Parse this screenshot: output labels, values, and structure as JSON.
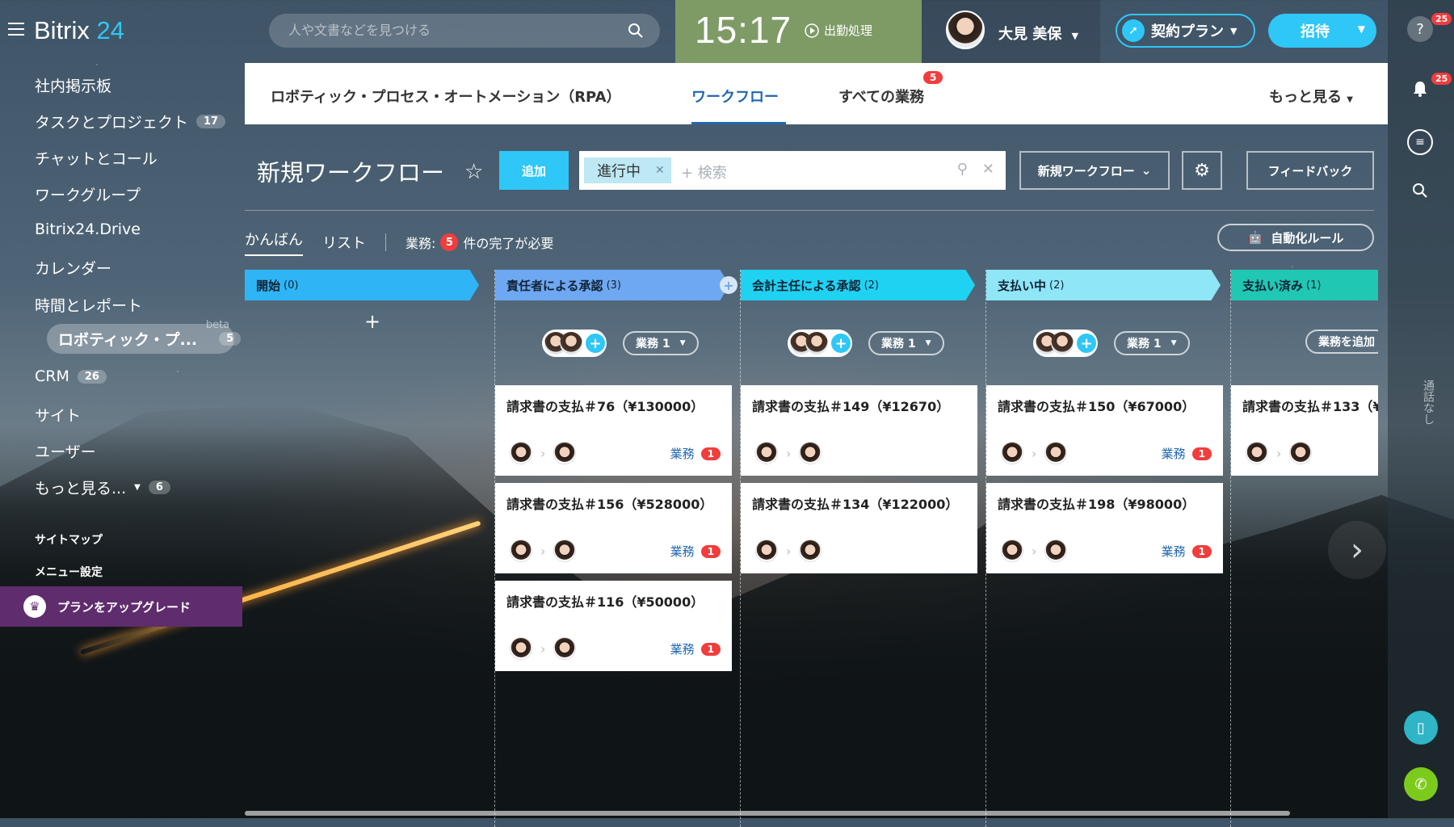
{
  "brand": {
    "name": "Bitrix",
    "num": "24"
  },
  "search": {
    "placeholder": "人や文書などを見つける"
  },
  "clock": {
    "time": "15:17",
    "attend": "出勤処理"
  },
  "user": {
    "name": "大見 美保"
  },
  "plan_label": "契約プラン",
  "invite_label": "招待",
  "rail": {
    "help_badge": "25",
    "bell_badge": "25",
    "vertical_text": "通話なし"
  },
  "sidebar": {
    "items": [
      {
        "label": "社内掲示板",
        "count": ""
      },
      {
        "label": "タスクとプロジェクト",
        "count": "17"
      },
      {
        "label": "チャットとコール",
        "count": ""
      },
      {
        "label": "ワークグループ",
        "count": ""
      },
      {
        "label": "Bitrix24.Drive",
        "count": ""
      },
      {
        "label": "カレンダー",
        "count": ""
      },
      {
        "label": "時間とレポート",
        "count": ""
      },
      {
        "label": "ロボティック・プ...",
        "count": "5",
        "beta": "beta"
      },
      {
        "label": "CRM",
        "count": "26"
      },
      {
        "label": "サイト",
        "count": ""
      },
      {
        "label": "ユーザー",
        "count": ""
      },
      {
        "label": "もっと見る...",
        "count": "6"
      }
    ],
    "sitemap": "サイトマップ",
    "menu_settings": "メニュー設定",
    "upgrade": "プランをアップグレード"
  },
  "tabs": {
    "rpa": "ロボティック・プロセス・オートメーション（RPA）",
    "workflow": "ワークフロー",
    "all_tasks": "すべての業務",
    "all_tasks_badge": "5",
    "more": "もっと見る"
  },
  "toolbar": {
    "title": "新規ワークフロー",
    "add": "追加",
    "filter_chip": "進行中",
    "filter_placeholder": "+ 検索",
    "new_workflow": "新規ワークフロー",
    "feedback": "フィードバック"
  },
  "view": {
    "kanban": "かんばん",
    "list": "リスト",
    "tasks_label": "業務:",
    "tasks_count": "5",
    "tasks_suffix": "件の完了が必要",
    "automation": "自動化ルール"
  },
  "columns": [
    {
      "title": "開始",
      "count": "(0)",
      "color": "#2fb5f5",
      "pill": "",
      "cards": []
    },
    {
      "title": "責任者による承認",
      "count": "(3)",
      "color": "#6ea7f2",
      "pill": "業務  1",
      "cards": [
        {
          "title": "請求書の支払＃76（¥130000）",
          "link": "業務",
          "n": "1"
        },
        {
          "title": "請求書の支払＃156（¥528000）",
          "link": "業務",
          "n": "1"
        },
        {
          "title": "請求書の支払＃116（¥50000）",
          "link": "業務",
          "n": "1"
        }
      ]
    },
    {
      "title": "会計主任による承認",
      "count": "(2)",
      "color": "#1fd2f2",
      "pill": "業務  1",
      "cards": [
        {
          "title": "請求書の支払＃149（¥12670）",
          "link": "",
          "n": ""
        },
        {
          "title": "請求書の支払＃134（¥122000）",
          "link": "",
          "n": ""
        }
      ]
    },
    {
      "title": "支払い中",
      "count": "(2)",
      "color": "#8ee6f7",
      "pill": "業務  1",
      "cards": [
        {
          "title": "請求書の支払＃150（¥67000）",
          "link": "業務",
          "n": "1"
        },
        {
          "title": "請求書の支払＃198（¥98000）",
          "link": "業務",
          "n": "1"
        }
      ]
    },
    {
      "title": "支払い済み",
      "count": "(1)",
      "color": "#20c7b3",
      "pill": "業務を追加",
      "cards": [
        {
          "title": "請求書の支払＃133（¥",
          "link": "",
          "n": ""
        }
      ]
    }
  ]
}
